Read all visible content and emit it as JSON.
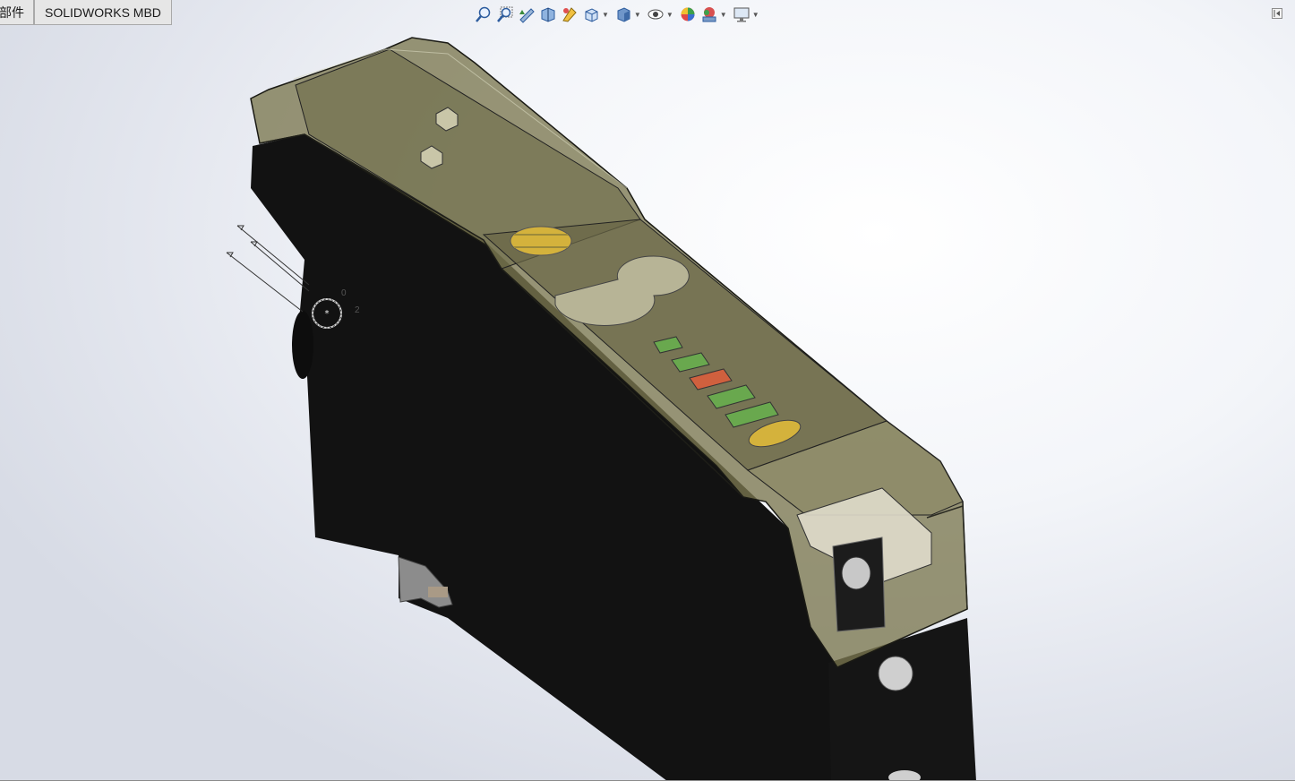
{
  "tabs": [
    {
      "label": "部件"
    },
    {
      "label": "SOLIDWORKS MBD"
    }
  ],
  "toolbar": [
    {
      "icon": "zoom-to-fit-icon"
    },
    {
      "icon": "zoom-to-area-icon"
    },
    {
      "icon": "previous-view-icon"
    },
    {
      "icon": "section-view-icon"
    },
    {
      "icon": "dynamic-annotation-icon"
    },
    {
      "icon": "view-orientation-icon",
      "dropdown": true
    },
    {
      "icon": "display-style-icon",
      "dropdown": true
    },
    {
      "icon": "hide-show-items-icon",
      "dropdown": true
    },
    {
      "icon": "edit-appearance-icon"
    },
    {
      "icon": "apply-scene-icon",
      "dropdown": true
    },
    {
      "icon": "view-settings-icon",
      "dropdown": true
    }
  ],
  "triad_labels": {
    "a": "0",
    "b": "2"
  },
  "colors": {
    "housing": "#121212",
    "cover": "#7b7750",
    "led_green": "#69a84e",
    "led_red": "#d0603e",
    "led_yellow": "#d4b23c"
  }
}
